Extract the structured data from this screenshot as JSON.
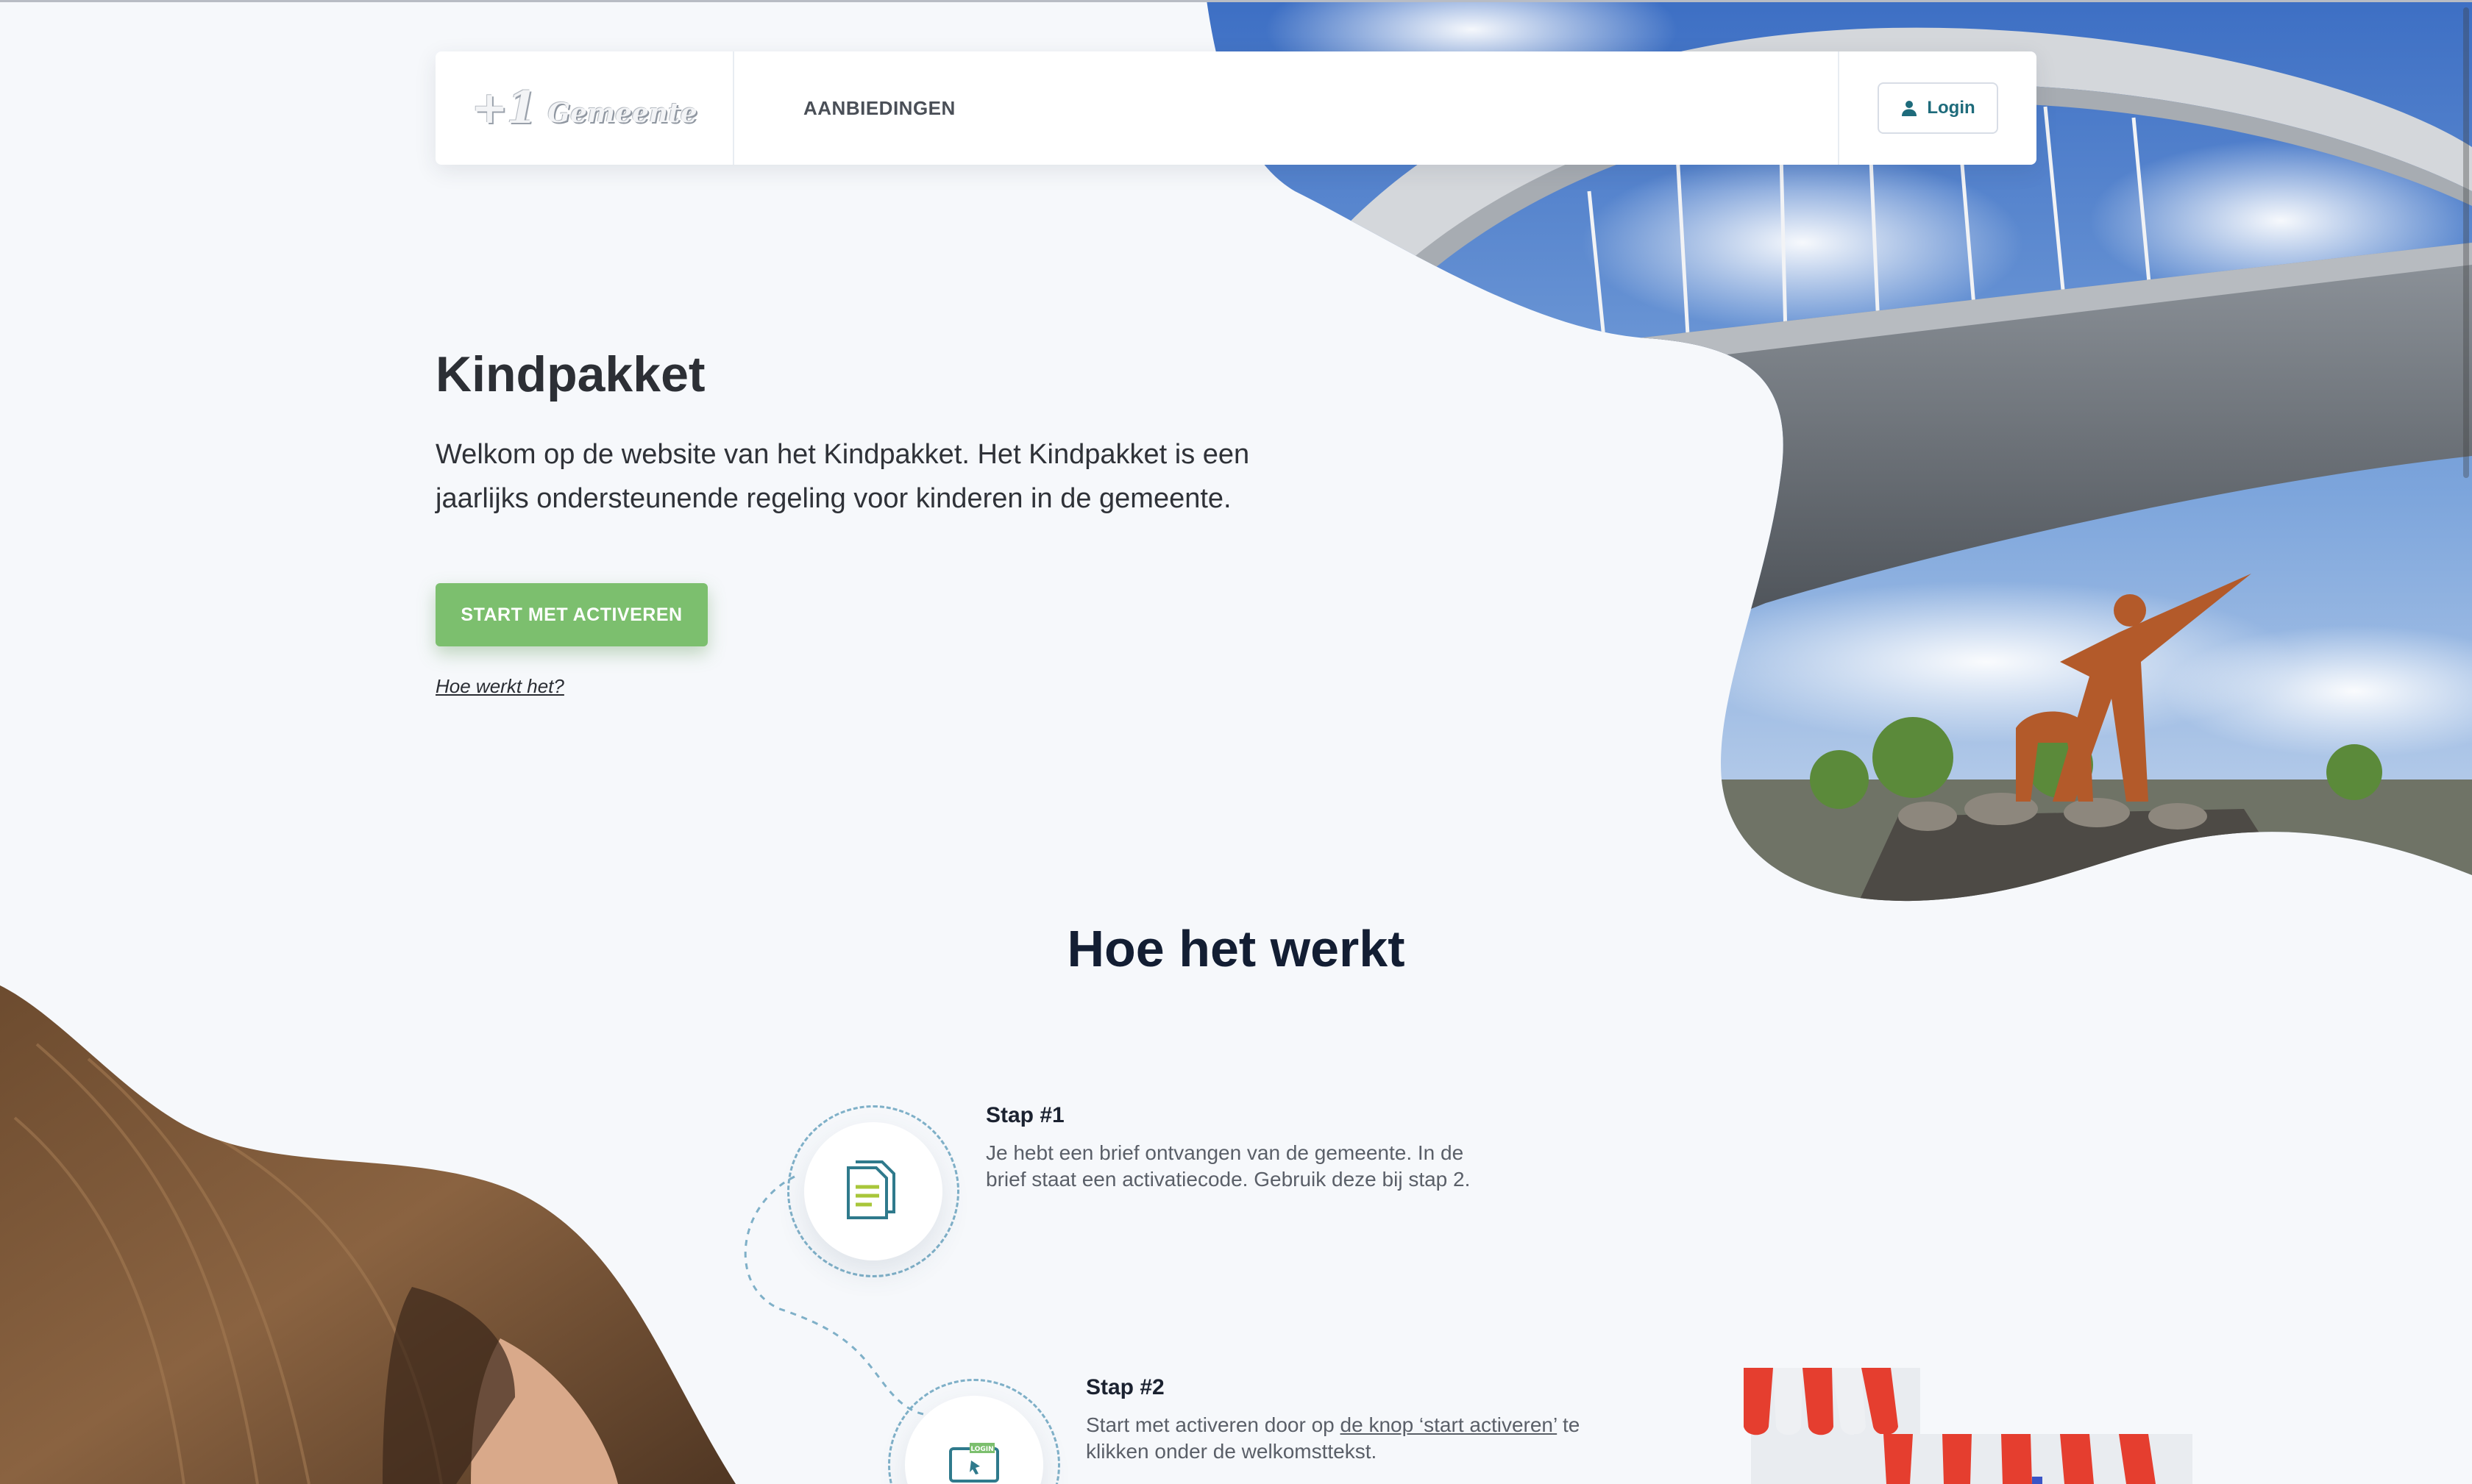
{
  "nav": {
    "logo_mark": "+1",
    "logo_text": "Gemeente",
    "links": [
      {
        "label": "AANBIEDINGEN"
      }
    ],
    "login_label": "Login"
  },
  "hero": {
    "title": "Kindpakket",
    "text": "Welkom op de website van het Kindpakket. Het Kindpakket is een jaarlijks ondersteunende regeling voor kinderen in de gemeente.",
    "cta_label": "START MET ACTIVEREN",
    "how_link": "Hoe werkt het?"
  },
  "how": {
    "title": "Hoe het werkt",
    "steps": [
      {
        "heading": "Stap #1",
        "body": "Je hebt een brief ontvangen van de gemeente. In de brief staat een activatiecode. Gebruik deze bij stap 2."
      },
      {
        "heading": "Stap #2",
        "body_before": "Start met activeren door op ",
        "body_link": "de knop ‘start activeren’",
        "body_after": " te klikken onder de welkomsttekst.",
        "icon_text": "LOGIN"
      }
    ]
  },
  "colors": {
    "accent_green": "#7cbf6e",
    "login_teal": "#1e6b7b",
    "title_navy": "#131e33"
  },
  "icons": [
    "user-icon",
    "document-icon",
    "laptop-login-icon",
    "shop-awning-icon"
  ]
}
